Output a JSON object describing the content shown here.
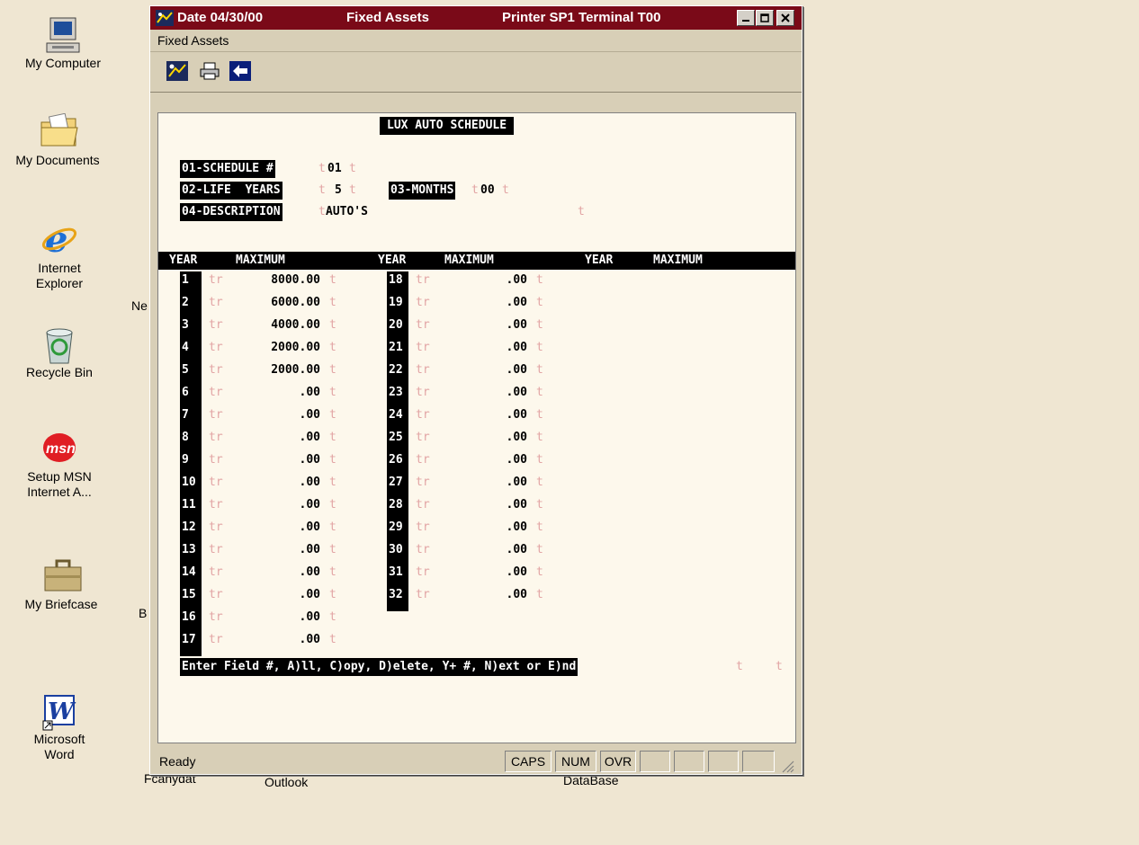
{
  "desktop": {
    "icons": [
      {
        "label": "My Computer"
      },
      {
        "label": "My Documents"
      },
      {
        "label": "Internet Explorer"
      },
      {
        "label": "Recycle Bin"
      },
      {
        "label": "Setup MSN Internet A..."
      },
      {
        "label": "My Briefcase"
      },
      {
        "label": "Microsoft Word"
      }
    ],
    "partial_labels": [
      "Ne",
      "B",
      "Fcanydat",
      "Outlook",
      "DataBase"
    ]
  },
  "window": {
    "title_date": "Date 04/30/00",
    "title_app": "Fixed Assets",
    "title_printer": "Printer  SP1 Terminal  T00",
    "menu": [
      "Fixed Assets"
    ],
    "toolbar": [
      "run-icon",
      "printer-icon",
      "back-arrow-icon"
    ],
    "screen": {
      "heading": "LUX AUTO SCHEDULE",
      "fields": {
        "schedule_label": "01-SCHEDULE #",
        "schedule_value": "01",
        "life_label": "02-LIFE  YEARS",
        "life_value": "5",
        "months_label": "03-MONTHS",
        "months_value": "00",
        "desc_label": "04-DESCRIPTION",
        "desc_value": "AUTO'S"
      },
      "header_year": "YEAR",
      "header_max": "MAXIMUM",
      "marker_t": "t",
      "marker_tr": "tr",
      "rows_col1": [
        {
          "year": "1",
          "max": "8000.00"
        },
        {
          "year": "2",
          "max": "6000.00"
        },
        {
          "year": "3",
          "max": "4000.00"
        },
        {
          "year": "4",
          "max": "2000.00"
        },
        {
          "year": "5",
          "max": "2000.00"
        },
        {
          "year": "6",
          "max": ".00"
        },
        {
          "year": "7",
          "max": ".00"
        },
        {
          "year": "8",
          "max": ".00"
        },
        {
          "year": "9",
          "max": ".00"
        },
        {
          "year": "10",
          "max": ".00"
        },
        {
          "year": "11",
          "max": ".00"
        },
        {
          "year": "12",
          "max": ".00"
        },
        {
          "year": "13",
          "max": ".00"
        },
        {
          "year": "14",
          "max": ".00"
        },
        {
          "year": "15",
          "max": ".00"
        },
        {
          "year": "16",
          "max": ".00"
        },
        {
          "year": "17",
          "max": ".00"
        }
      ],
      "rows_col2": [
        {
          "year": "18",
          "max": ".00"
        },
        {
          "year": "19",
          "max": ".00"
        },
        {
          "year": "20",
          "max": ".00"
        },
        {
          "year": "21",
          "max": ".00"
        },
        {
          "year": "22",
          "max": ".00"
        },
        {
          "year": "23",
          "max": ".00"
        },
        {
          "year": "24",
          "max": ".00"
        },
        {
          "year": "25",
          "max": ".00"
        },
        {
          "year": "26",
          "max": ".00"
        },
        {
          "year": "27",
          "max": ".00"
        },
        {
          "year": "28",
          "max": ".00"
        },
        {
          "year": "29",
          "max": ".00"
        },
        {
          "year": "30",
          "max": ".00"
        },
        {
          "year": "31",
          "max": ".00"
        },
        {
          "year": "32",
          "max": ".00"
        }
      ],
      "prompt": "Enter Field #, A)ll, C)opy, D)elete, Y+ #, N)ext or E)nd"
    },
    "status": {
      "text": "Ready",
      "caps": "CAPS",
      "num": "NUM",
      "ovr": "OVR"
    }
  }
}
